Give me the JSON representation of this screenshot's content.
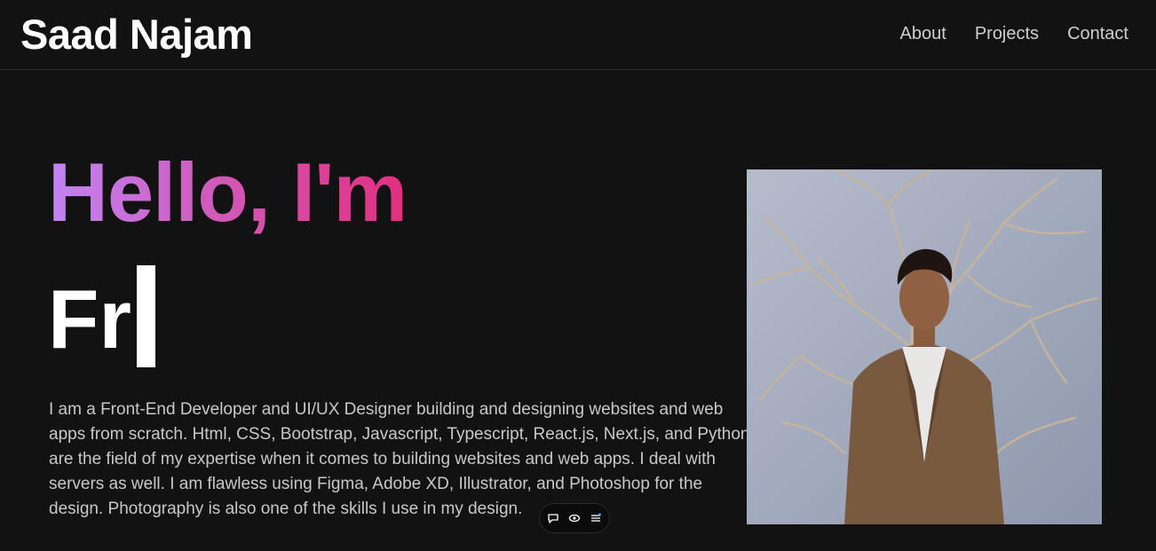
{
  "header": {
    "brand": "Saad Najam",
    "nav": [
      {
        "label": "About"
      },
      {
        "label": "Projects"
      },
      {
        "label": "Contact"
      }
    ]
  },
  "hero": {
    "greeting": "Hello, I'm",
    "typing_text": "Fr",
    "bio": "I am a Front-End Developer and UI/UX Designer building and designing websites and web apps from scratch. Html, CSS, Bootstrap, Javascript, Typescript, React.js, Next.js, and Python are the field of my expertise when it comes to building websites and web apps. I deal with servers as well. I am flawless using Figma, Adobe XD, Illustrator, and Photoshop for the design. Photography is also one of the skills I use in my design."
  },
  "floating_toolbar": {
    "icons": [
      "comment-icon",
      "eye-icon",
      "menu-icon"
    ]
  },
  "colors": {
    "background": "#121212",
    "gradient_start": "#c184f5",
    "gradient_end": "#e22f7f",
    "text_muted": "#c8c8c8"
  }
}
